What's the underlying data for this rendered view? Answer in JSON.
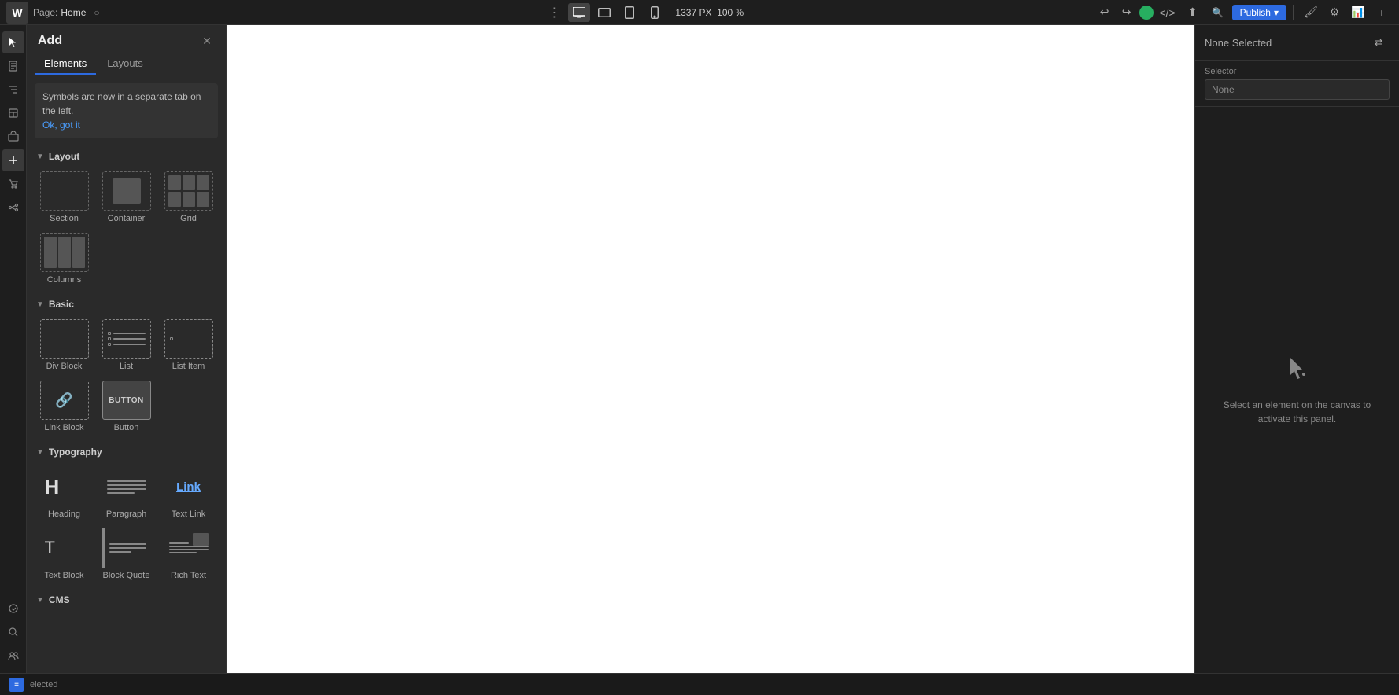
{
  "topbar": {
    "logo": "W",
    "page_label": "Page:",
    "page_name": "Home",
    "px_label": "1337 PX",
    "zoom": "100 %",
    "publish_label": "Publish",
    "devices": [
      {
        "name": "desktop",
        "icon": "🖥"
      },
      {
        "name": "tablet-landscape",
        "icon": "⬜"
      },
      {
        "name": "tablet-portrait",
        "icon": "⬛"
      },
      {
        "name": "mobile",
        "icon": "📱"
      }
    ]
  },
  "add_panel": {
    "title": "Add",
    "close_icon": "✕",
    "tabs": [
      {
        "label": "Elements",
        "active": true
      },
      {
        "label": "Layouts",
        "active": false
      }
    ],
    "info_message": "Symbols are now in a separate tab on the left.",
    "info_link": "Ok, got it",
    "sections": {
      "layout": {
        "label": "Layout",
        "items": [
          {
            "name": "Section",
            "label": "Section"
          },
          {
            "name": "Container",
            "label": "Container"
          },
          {
            "name": "Grid",
            "label": "Grid"
          },
          {
            "name": "Columns",
            "label": "Columns"
          }
        ]
      },
      "basic": {
        "label": "Basic",
        "items": [
          {
            "name": "Div Block",
            "label": "Div Block"
          },
          {
            "name": "List",
            "label": "List"
          },
          {
            "name": "List Item",
            "label": "List Item"
          },
          {
            "name": "Link Block",
            "label": "Link Block"
          },
          {
            "name": "Button",
            "label": "Button"
          }
        ]
      },
      "typography": {
        "label": "Typography",
        "items": [
          {
            "name": "Heading",
            "label": "Heading"
          },
          {
            "name": "Paragraph",
            "label": "Paragraph"
          },
          {
            "name": "Text Link",
            "label": "Text Link"
          },
          {
            "name": "Text Block",
            "label": "Text Block"
          },
          {
            "name": "Block Quote",
            "label": "Block Quote"
          },
          {
            "name": "Rich Text",
            "label": "Rich Text"
          }
        ]
      },
      "cms": {
        "label": "CMS"
      }
    }
  },
  "right_panel": {
    "title": "None Selected",
    "selector_label": "Selector",
    "selector_value": "None",
    "empty_message": "Select an element on the canvas to activate this panel."
  },
  "status_bar": {
    "icon": "≡",
    "text": "elected"
  }
}
